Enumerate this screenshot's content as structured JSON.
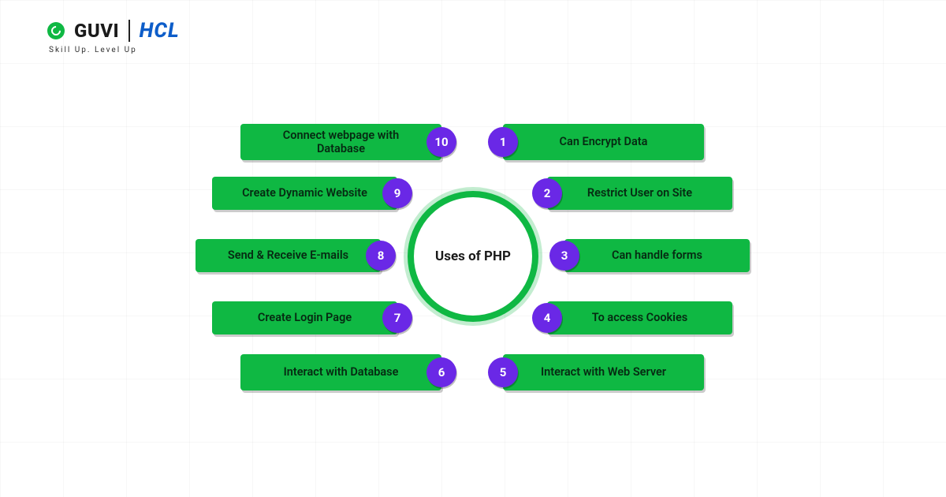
{
  "brand": {
    "guvi": "GUVI",
    "hcl": "HCL",
    "tagline": "Skill Up. Level Up"
  },
  "center_label": "Uses of PHP",
  "colors": {
    "pill": "#0fb843",
    "num": "#6a28e6"
  },
  "items_right": [
    {
      "n": "1",
      "label": "Can Encrypt Data"
    },
    {
      "n": "2",
      "label": "Restrict User on Site"
    },
    {
      "n": "3",
      "label": "Can handle forms"
    },
    {
      "n": "4",
      "label": "To access Cookies"
    },
    {
      "n": "5",
      "label": "Interact with Web Server"
    }
  ],
  "items_left": [
    {
      "n": "10",
      "label": "Connect webpage with Database"
    },
    {
      "n": "9",
      "label": "Create Dynamic Website"
    },
    {
      "n": "8",
      "label": "Send & Receive E-mails"
    },
    {
      "n": "7",
      "label": "Create Login Page"
    },
    {
      "n": "6",
      "label": "Interact with Database"
    }
  ]
}
